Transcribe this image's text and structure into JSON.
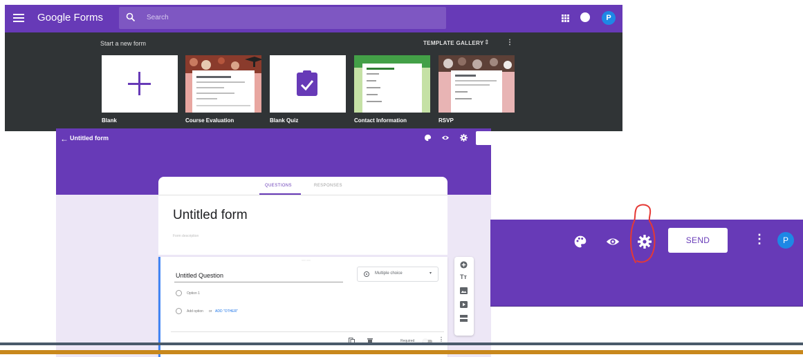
{
  "home": {
    "app_title": "Google Forms",
    "search_placeholder": "Search",
    "avatar_initial": "P",
    "start_label": "Start a new form",
    "template_gallery_label": "TEMPLATE GALLERY",
    "templates": [
      {
        "label": "Blank"
      },
      {
        "label": "Course Evaluation"
      },
      {
        "label": "Blank Quiz"
      },
      {
        "label": "Contact Information"
      },
      {
        "label": "RSVP"
      }
    ]
  },
  "editor": {
    "title": "Untitled form",
    "tabs": [
      {
        "label": "QUESTIONS",
        "active": true
      },
      {
        "label": "RESPONSES",
        "active": false
      }
    ],
    "form_title": "Untitled form",
    "form_description": "Form description",
    "question": {
      "title": "Untitled Question",
      "type_label": "Multiple choice",
      "option1": "Option 1",
      "add_option": "Add option",
      "or_text": "or",
      "add_other": "ADD \"OTHER\"",
      "required_label": "Required"
    }
  },
  "zoom": {
    "send_label": "SEND",
    "avatar_initial": "P"
  },
  "colors": {
    "primary_purple": "#673ab7",
    "search_bg": "#7e57c2",
    "dark_panel": "#303436",
    "editor_bg": "#ede7f6",
    "accent_blue": "#4285f4",
    "annotation_red": "#e53935"
  }
}
